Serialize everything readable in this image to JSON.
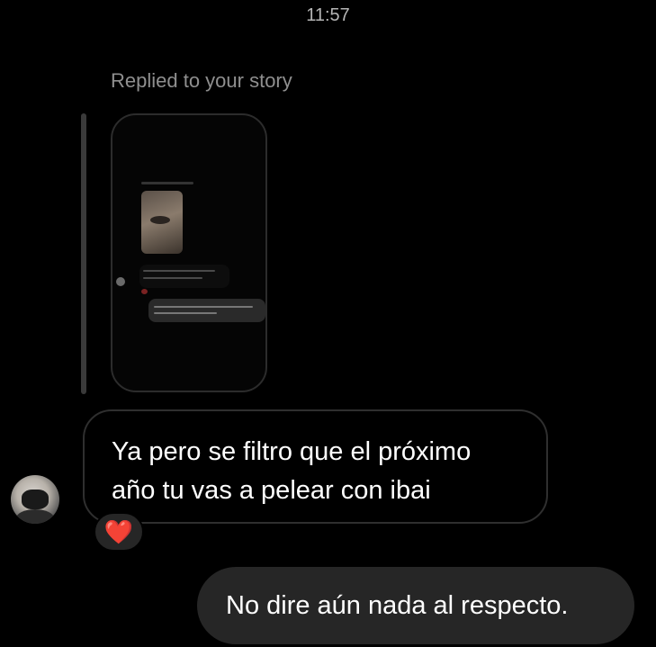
{
  "thread": {
    "timestamp": "11:57",
    "reply_context": {
      "label": "Replied to your story",
      "story_preview_icon": "story-thumbnail-icon"
    },
    "messages": [
      {
        "direction": "received",
        "text": "Ya pero se filtro que el próximo año tu vas a pelear con ibai",
        "reaction": "❤️",
        "reaction_icon": "heart-reaction-icon"
      },
      {
        "direction": "sent",
        "text": "No dire aún nada al respecto."
      }
    ]
  },
  "colors": {
    "background": "#000000",
    "sent_bubble": "#262626",
    "received_border": "#2f2f2f",
    "secondary_text": "#8f8f8f",
    "heart": "#e0245e"
  }
}
